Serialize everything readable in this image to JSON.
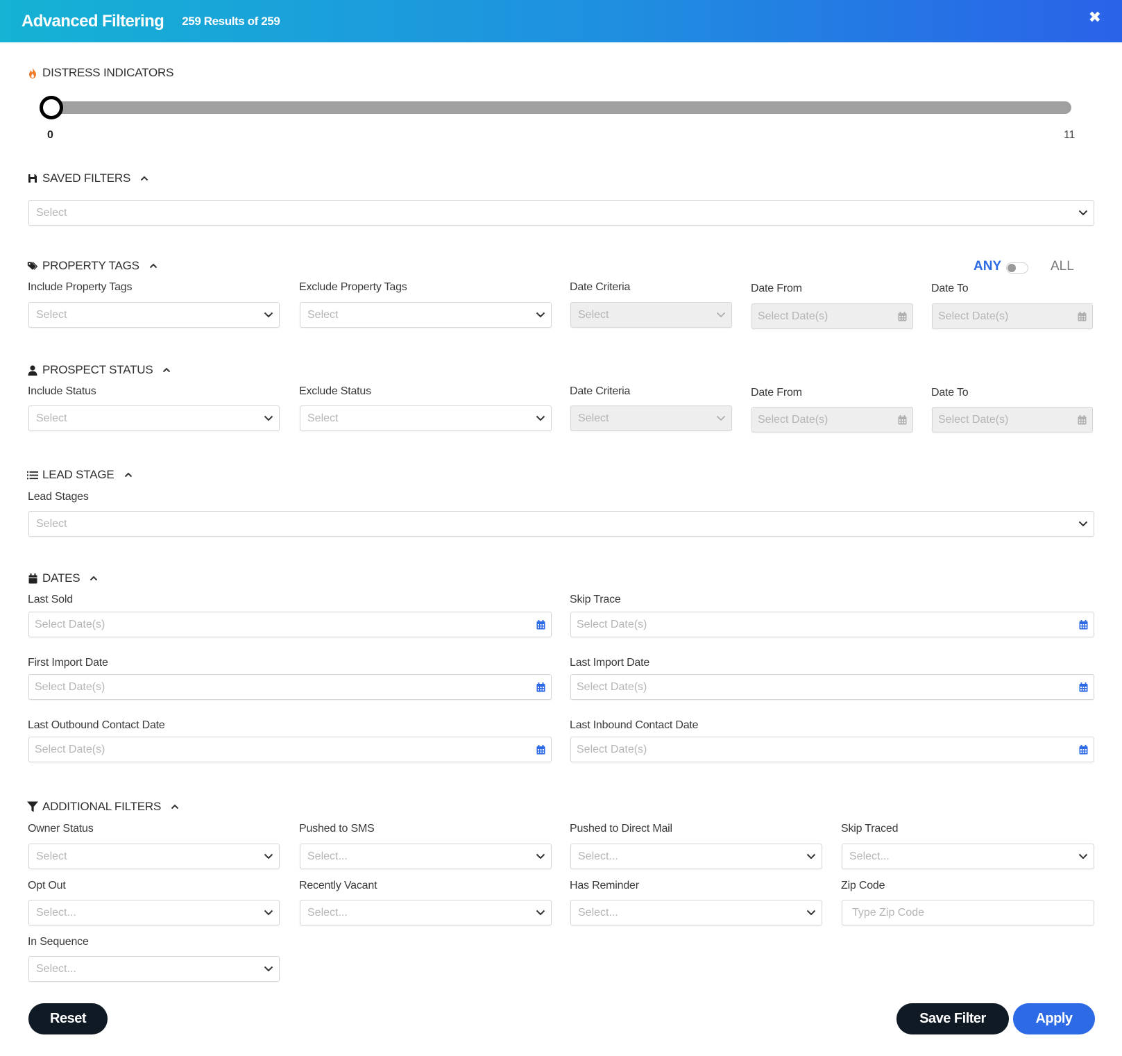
{
  "header": {
    "title": "Advanced Filtering",
    "results": "259 Results of 259",
    "close_glyph": "✖"
  },
  "distress": {
    "title": "DISTRESS INDICATORS",
    "min": "0",
    "max": "11",
    "value": 0
  },
  "saved_filters": {
    "title": "SAVED FILTERS",
    "placeholder": "Select"
  },
  "property_tags": {
    "title": "PROPERTY TAGS",
    "any_label": "ANY",
    "all_label": "ALL",
    "include_label": "Include Property Tags",
    "include_placeholder": "Select",
    "exclude_label": "Exclude Property Tags",
    "exclude_placeholder": "Select",
    "date_criteria_label": "Date Criteria",
    "date_criteria_placeholder": "Select",
    "date_from_label": "Date From",
    "date_from_placeholder": "Select Date(s)",
    "date_to_label": "Date To",
    "date_to_placeholder": "Select Date(s)"
  },
  "prospect_status": {
    "title": "PROSPECT STATUS",
    "include_label": "Include Status",
    "include_placeholder": "Select",
    "exclude_label": "Exclude Status",
    "exclude_placeholder": "Select",
    "date_criteria_label": "Date Criteria",
    "date_criteria_placeholder": "Select",
    "date_from_label": "Date From",
    "date_from_placeholder": "Select Date(s)",
    "date_to_label": "Date To",
    "date_to_placeholder": "Select Date(s)"
  },
  "lead_stage": {
    "title": "LEAD STAGE",
    "label": "Lead Stages",
    "placeholder": "Select"
  },
  "dates": {
    "title": "DATES",
    "last_sold_label": "Last Sold",
    "skip_trace_label": "Skip Trace",
    "first_import_label": "First Import Date",
    "last_import_label": "Last Import Date",
    "last_outbound_label": "Last Outbound Contact Date",
    "last_inbound_label": "Last Inbound Contact Date",
    "placeholder": "Select Date(s)"
  },
  "additional": {
    "title": "ADDITIONAL FILTERS",
    "owner_status_label": "Owner Status",
    "owner_status_placeholder": "Select",
    "pushed_sms_label": "Pushed to SMS",
    "pushed_sms_placeholder": "Select...",
    "pushed_mail_label": "Pushed to Direct Mail",
    "pushed_mail_placeholder": "Select...",
    "skip_traced_label": "Skip Traced",
    "skip_traced_placeholder": "Select...",
    "opt_out_label": "Opt Out",
    "opt_out_placeholder": "Select...",
    "recently_vacant_label": "Recently Vacant",
    "recently_vacant_placeholder": "Select...",
    "has_reminder_label": "Has Reminder",
    "has_reminder_placeholder": "Select...",
    "zip_code_label": "Zip Code",
    "zip_code_placeholder": "Type Zip Code",
    "in_sequence_label": "In Sequence",
    "in_sequence_placeholder": "Select..."
  },
  "buttons": {
    "reset": "Reset",
    "save_filter": "Save Filter",
    "apply": "Apply"
  },
  "colors": {
    "accent": "#2d6ae6",
    "dark_button": "#0f1a24",
    "header_start": "#15b2d4",
    "header_end": "#2a62e8",
    "flame": "#f07a28"
  }
}
